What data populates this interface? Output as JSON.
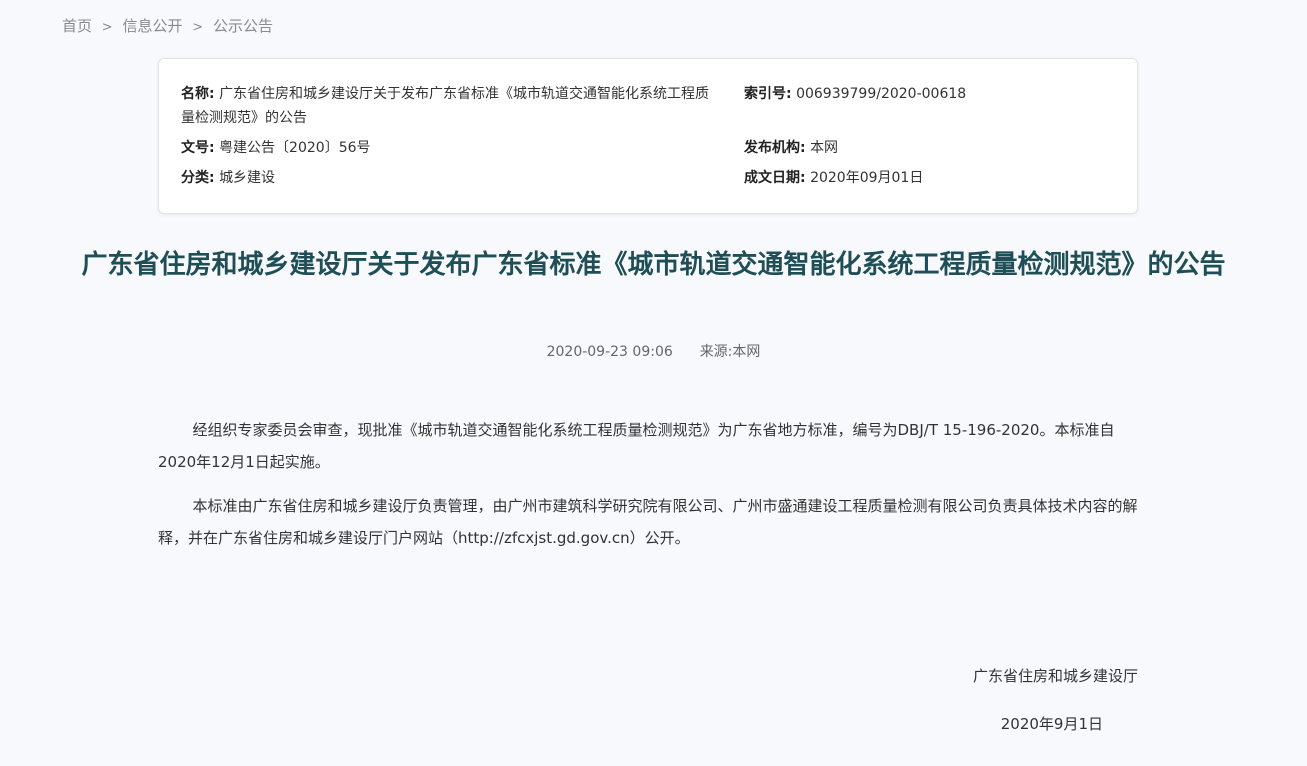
{
  "breadcrumb": {
    "items": [
      "首页",
      "信息公开",
      "公示公告"
    ],
    "separator": ">"
  },
  "meta": {
    "name_label": "名称:",
    "name_value": "广东省住房和城乡建设厅关于发布广东省标准《城市轨道交通智能化系统工程质量检测规范》的公告",
    "index_label": "索引号:",
    "index_value": "006939799/2020-00618",
    "docno_label": "文号:",
    "docno_value": "粤建公告〔2020〕56号",
    "publisher_label": "发布机构:",
    "publisher_value": "本网",
    "category_label": "分类:",
    "category_value": "城乡建设",
    "date_label": "成文日期:",
    "date_value": "2020年09月01日"
  },
  "article": {
    "title": "广东省住房和城乡建设厅关于发布广东省标准《城市轨道交通智能化系统工程质量检测规范》的公告",
    "publish_date": "2020-09-23",
    "publish_time": "09:06",
    "source": "来源:本网",
    "paragraphs": [
      "经组织专家委员会审查，现批准《城市轨道交通智能化系统工程质量检测规范》为广东省地方标准，编号为DBJ/T 15-196-2020。本标准自2020年12月1日起实施。",
      "本标准由广东省住房和城乡建设厅负责管理，由广州市建筑科学研究院有限公司、广州市盛通建设工程质量检测有限公司负责具体技术内容的解释，并在广东省住房和城乡建设厅门户网站（http://zfcxjst.gd.gov.cn）公开。"
    ],
    "signature_org": "广东省住房和城乡建设厅",
    "signature_date": "2020年9月1日"
  }
}
